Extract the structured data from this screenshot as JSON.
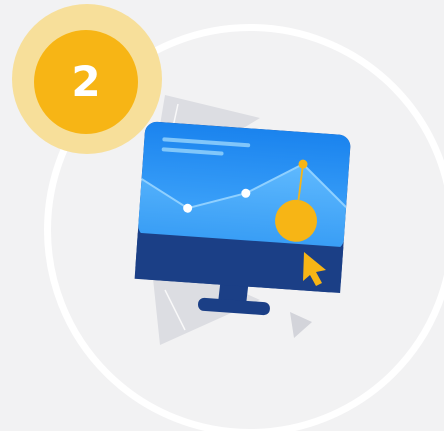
{
  "step": {
    "number": "2"
  },
  "colors": {
    "background": "#f2f2f3",
    "ring": "#ffffff",
    "badge": "#f7b515",
    "badge_halo": "#f7df9a",
    "screen_top": "#1e8cf0",
    "screen_bottom": "#1b3f86",
    "accent": "#f7b515",
    "decor": "#d9dadf"
  },
  "icons": {
    "monitor": "monitor-chart-icon",
    "cursor": "cursor-arrow-icon"
  }
}
